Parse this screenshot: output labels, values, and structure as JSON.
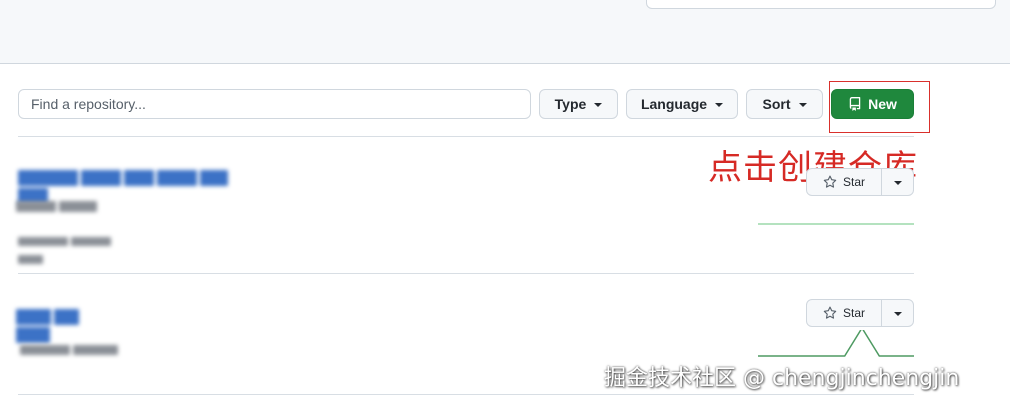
{
  "search": {
    "placeholder": "Find a repository..."
  },
  "filters": {
    "type_label": "Type",
    "language_label": "Language",
    "sort_label": "Sort"
  },
  "new_button": {
    "label": "New",
    "icon": "repo-book-icon"
  },
  "annotation": {
    "text": "点击创建仓库",
    "color": "#d62a25"
  },
  "repositories": [
    {
      "star_label": "Star",
      "activity": [
        0,
        0,
        0,
        0,
        0,
        0,
        0,
        0
      ]
    },
    {
      "star_label": "Star",
      "activity": [
        0,
        0,
        0,
        0,
        0,
        0,
        1,
        0,
        0,
        0
      ]
    }
  ],
  "watermark": {
    "text": "掘金技术社区 @ chengjinchengjin"
  },
  "colors": {
    "primary_button": "#1f883d",
    "link": "#3c72c6",
    "sparkline_light": "#9bd9aa",
    "sparkline_dark": "#4e9a62"
  }
}
